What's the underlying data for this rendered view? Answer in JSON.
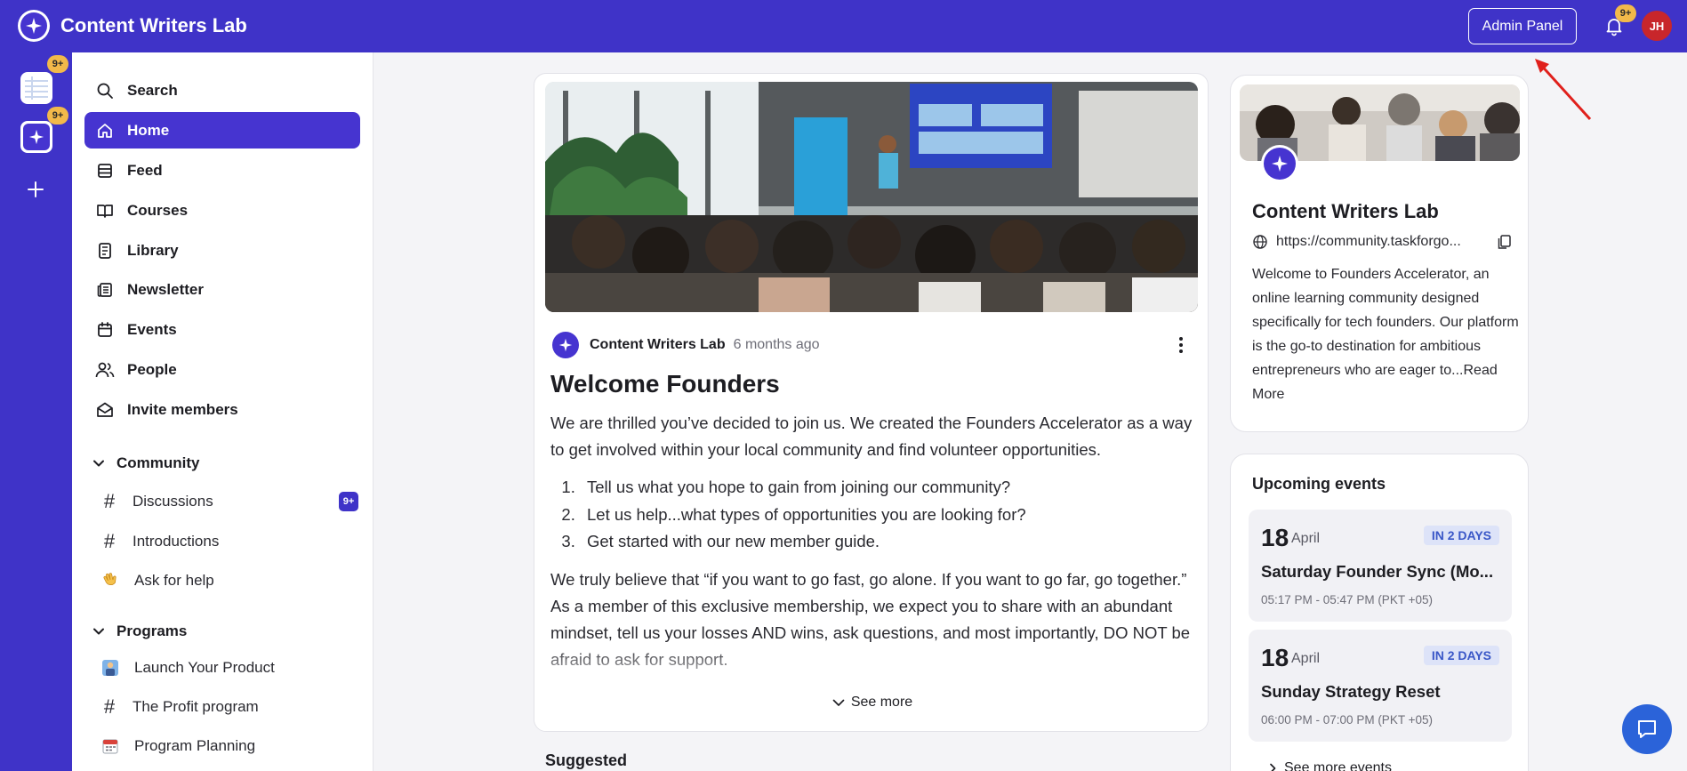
{
  "app": {
    "name": "Content Writers Lab"
  },
  "header": {
    "admin_label": "Admin Panel",
    "notif_badge": "9+",
    "user_initials": "JH"
  },
  "rail": {
    "badge1": "9+",
    "badge2": "9+"
  },
  "sidebar": {
    "nav": [
      {
        "label": "Search",
        "icon": "search-icon"
      },
      {
        "label": "Home",
        "icon": "home-icon"
      },
      {
        "label": "Feed",
        "icon": "feed-icon"
      },
      {
        "label": "Courses",
        "icon": "book-icon"
      },
      {
        "label": "Library",
        "icon": "library-icon"
      },
      {
        "label": "Newsletter",
        "icon": "newspaper-icon"
      },
      {
        "label": "Events",
        "icon": "calendar-icon"
      },
      {
        "label": "People",
        "icon": "people-icon"
      },
      {
        "label": "Invite members",
        "icon": "envelope-icon"
      }
    ],
    "community": {
      "title": "Community",
      "items": [
        {
          "label": "Discussions",
          "badge": "9+"
        },
        {
          "label": "Introductions"
        },
        {
          "label": "Ask for help"
        }
      ]
    },
    "programs": {
      "title": "Programs",
      "items": [
        {
          "label": "Launch Your Product"
        },
        {
          "label": "The Profit program"
        },
        {
          "label": "Program Planning"
        }
      ]
    }
  },
  "post": {
    "author": "Content Writers Lab",
    "time": "6 months ago",
    "title": "Welcome Founders",
    "intro": "We are thrilled you’ve decided to join us. We created the Founders Accelerator as a way to get involved within your local community and find volunteer opportunities.",
    "list": [
      "Tell us what you hope to gain from joining our community?",
      "Let us help...what types of opportunities you are looking for?",
      "Get started with our new member guide."
    ],
    "para2": "We truly believe that “if you want to go fast, go alone. If you want to go far, go together.” As a member of this exclusive membership, we expect you to share with an abundant mindset, tell us your losses AND wins, ask questions, and most importantly, DO NOT be afraid to ask for support.",
    "see_more": "See more"
  },
  "suggested": {
    "title": "Suggested"
  },
  "about": {
    "title": "Content Writers Lab",
    "url": "https://community.taskforgo...",
    "desc": "Welcome to Founders Accelerator, an online learning community designed specifically for tech founders. Our platform is the go-to destination for ambitious entrepreneurs who are eager to...",
    "read_more": "Read More"
  },
  "events": {
    "title": "Upcoming events",
    "items": [
      {
        "day": "18",
        "month": "April",
        "badge": "IN 2 DAYS",
        "name": "Saturday Founder Sync (Mo...",
        "time": "05:17 PM - 05:47 PM (PKT +05)"
      },
      {
        "day": "18",
        "month": "April",
        "badge": "IN 2 DAYS",
        "name": "Sunday Strategy Reset",
        "time": "06:00 PM - 07:00 PM (PKT +05)"
      }
    ],
    "see_more": "See more events"
  },
  "colors": {
    "brand": "#3f33c8",
    "accent": "#4634d0",
    "badge": "#f2b94a",
    "event_badge_bg": "#dde3f8",
    "event_badge_text": "#3a57c7"
  }
}
